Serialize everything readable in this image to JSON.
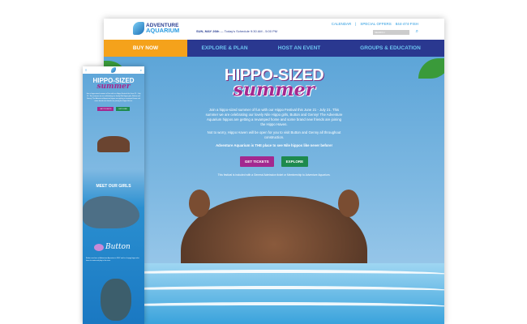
{
  "desktop": {
    "logo": {
      "line1": "ADVENTURE",
      "line2": "AQUARIUM"
    },
    "schedule_date": "SUN, MAY 26th",
    "schedule_text": "— Today's Schedule 9:30 AM - 5:00 PM",
    "top_links": [
      "CALENDAR",
      "|",
      "SPECIAL OFFERS",
      "844-474-FISH"
    ],
    "search_placeholder": "SEARCH",
    "nav": [
      "BUY NOW",
      "EXPLORE & PLAN",
      "HOST AN EVENT",
      "GROUPS & EDUCATION"
    ],
    "hero": {
      "title1": "HIPPO-SIZED",
      "title2": "summer",
      "p1": "Join a hippo-sized summer of fun with our Hippo Festival this June 21 - July 21. This summer we are celebrating our lovely Nile Hippo girls, Button and Genny! The Adventure Aquarium hippos are getting a revamped home and some brand new friends are joining the Hippo Haven.",
      "p2": "Not to worry, Hippo Haven will be open for you to visit Button and Genny all throughout construction.",
      "p3": "Adventure Aquarium is THE place to see Nile hippos like never before!",
      "btn_tickets": "GET TICKETS",
      "btn_explore": "EXPLORE",
      "note": "This festival is included with a General Admission ticket or Membership to Adventure Aquarium."
    }
  },
  "mobile": {
    "meet": "MEET OUR GIRLS",
    "button_name": "Button",
    "button_text": "Button was born at Adventure Aquarium in 2007 and is a happy hippo who loves to swim and play in the river."
  },
  "colors": {
    "nav": "#2a3890",
    "buy": "#f5a21b",
    "tickets": "#a3288f",
    "explore": "#1e8a4e"
  }
}
